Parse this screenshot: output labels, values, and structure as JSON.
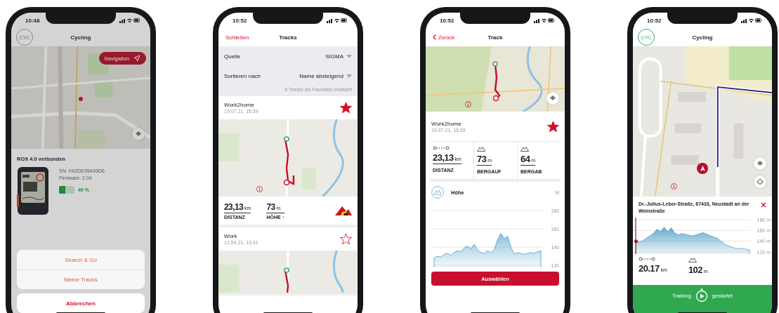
{
  "device_screen": {
    "status_time": "10:48",
    "sport_badge": "CYC",
    "title": "Cycling",
    "nav_button": "Navigation",
    "device_heading": "ROX 4.0 verbunden",
    "serial": "SN: FA2DE95A99D6",
    "firmware": "Firmware: 2.04",
    "battery": {
      "level": 0.4,
      "reading": "40 %"
    },
    "actions": [
      {
        "label": "Search & Go",
        "kind": "option"
      },
      {
        "label": "Meine Tracks",
        "kind": "option"
      },
      {
        "label": "Abbrechen",
        "kind": "cancel"
      }
    ]
  },
  "tracks_screen": {
    "status_time": "10:52",
    "close_link": "Schließen",
    "title": "Tracks",
    "filters": [
      {
        "label": "Quelle",
        "value": "SIGMA"
      },
      {
        "label": "Sortieren nach",
        "value": "Name absteigend"
      }
    ],
    "favorites_note": "6 Tracks als Favoriten markiert",
    "tracks": [
      {
        "name": "Work2home",
        "date": "19.07.21, 15:39",
        "favorite": true,
        "stats": [
          {
            "value": "23,13",
            "unit": "km",
            "label": "DISTANZ"
          },
          {
            "value": "73",
            "unit": "m",
            "label": "HÖHE ↑"
          }
        ]
      },
      {
        "name": "Work",
        "date": "12.04.21, 13:41",
        "favorite": false
      }
    ]
  },
  "track_screen": {
    "status_time": "10:52",
    "back_link": "Zurück",
    "title": "Track",
    "name": "Work2home",
    "date": "19.07.21, 15:39",
    "favorite": true,
    "stats": [
      {
        "kind": "distance",
        "value": "23,13",
        "unit": "km",
        "label": "DISTANZ"
      },
      {
        "kind": "ascent",
        "value": "73",
        "unit": "m",
        "label": "BERGAUF"
      },
      {
        "kind": "descent",
        "value": "64",
        "unit": "m",
        "label": "BERGAB"
      }
    ],
    "elevation": {
      "title": "Höhe",
      "unit": "M",
      "chart_data": {
        "type": "area",
        "grid": true,
        "ylim": [
          120,
          180
        ],
        "yticks": [
          180,
          160,
          140,
          120
        ],
        "values": [
          128,
          130,
          129,
          132,
          133,
          131,
          134,
          136,
          135,
          139,
          141,
          138,
          143,
          137,
          134,
          133,
          136,
          134,
          137,
          148,
          155,
          149,
          152,
          140,
          132,
          134,
          133,
          132,
          133,
          134,
          133,
          135,
          136
        ]
      }
    },
    "select_button": "Auswählen"
  },
  "navigation_screen": {
    "status_time": "10:52",
    "sport_badge": "CYC",
    "title": "Cycling",
    "address": "Dr.-Julius-Leber-Straße, 67433, Neustadt an der Weinstraße",
    "elevation_chart": {
      "chart_data": {
        "type": "area",
        "grid": true,
        "ylim": [
          120,
          180
        ],
        "yticks": [
          {
            "value": 180,
            "label": "180 m"
          },
          {
            "value": 160,
            "label": "160 m"
          },
          {
            "value": 140,
            "label": "140 m"
          },
          {
            "value": 120,
            "label": "120 m"
          }
        ],
        "values": [
          140,
          139,
          141,
          146,
          150,
          155,
          162,
          158,
          166,
          158,
          165,
          155,
          152,
          154,
          153,
          151,
          150,
          152,
          154,
          156,
          153,
          150,
          148,
          145,
          140,
          135,
          131,
          129,
          127,
          126,
          127,
          125,
          124
        ]
      }
    },
    "stats": [
      {
        "kind": "distance",
        "value": "20.17",
        "unit": "km"
      },
      {
        "kind": "ascent",
        "value": "102",
        "unit": "m"
      }
    ],
    "status": {
      "before": "Training",
      "after": "gestartet"
    }
  }
}
